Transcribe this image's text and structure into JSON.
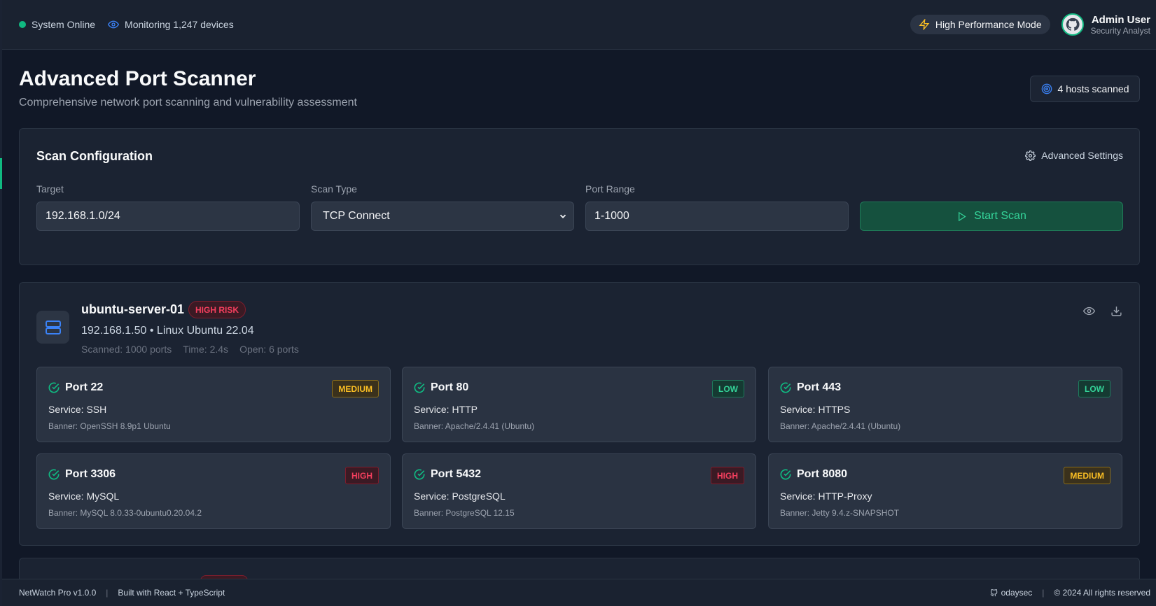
{
  "topbar": {
    "system_status": "System Online",
    "monitoring": "Monitoring 1,247 devices",
    "perf_mode": "High Performance Mode",
    "user_name": "Admin User",
    "user_role": "Security Analyst"
  },
  "header": {
    "title": "Advanced Port Scanner",
    "subtitle": "Comprehensive network port scanning and vulnerability assessment",
    "hosts_scanned": "4 hosts scanned"
  },
  "config": {
    "title": "Scan Configuration",
    "advanced_settings": "Advanced Settings",
    "target_label": "Target",
    "target_value": "192.168.1.0/24",
    "scan_type_label": "Scan Type",
    "scan_type_value": "TCP Connect",
    "port_range_label": "Port Range",
    "port_range_value": "1-1000",
    "start_button": "Start Scan"
  },
  "host": {
    "name": "ubuntu-server-01",
    "risk": "HIGH RISK",
    "meta": "192.168.1.50 • Linux Ubuntu 22.04",
    "scanned": "Scanned: 1000 ports",
    "time": "Time: 2.4s",
    "open": "Open: 6 ports",
    "ports": [
      {
        "title": "Port 22",
        "severity": "MEDIUM",
        "service": "Service: SSH",
        "banner": "Banner: OpenSSH 8.9p1 Ubuntu"
      },
      {
        "title": "Port 80",
        "severity": "LOW",
        "service": "Service: HTTP",
        "banner": "Banner: Apache/2.4.41 (Ubuntu)"
      },
      {
        "title": "Port 443",
        "severity": "LOW",
        "service": "Service: HTTPS",
        "banner": "Banner: Apache/2.4.41 (Ubuntu)"
      },
      {
        "title": "Port 3306",
        "severity": "HIGH",
        "service": "Service: MySQL",
        "banner": "Banner: MySQL 8.0.33-0ubuntu0.20.04.2"
      },
      {
        "title": "Port 5432",
        "severity": "HIGH",
        "service": "Service: PostgreSQL",
        "banner": "Banner: PostgreSQL 12.15"
      },
      {
        "title": "Port 8080",
        "severity": "MEDIUM",
        "service": "Service: HTTP-Proxy",
        "banner": "Banner: Jetty 9.4.z-SNAPSHOT"
      }
    ]
  },
  "footer": {
    "version": "NetWatch Pro v1.0.0",
    "built_with": "Built with React + TypeScript",
    "github": "odaysec",
    "copyright": "© 2024 All rights reserved"
  },
  "colors": {
    "accent": "#10b981",
    "background": "#111827",
    "card": "#1b2332",
    "high": "#f43f5e",
    "medium": "#fbbf24",
    "low": "#34d399"
  }
}
